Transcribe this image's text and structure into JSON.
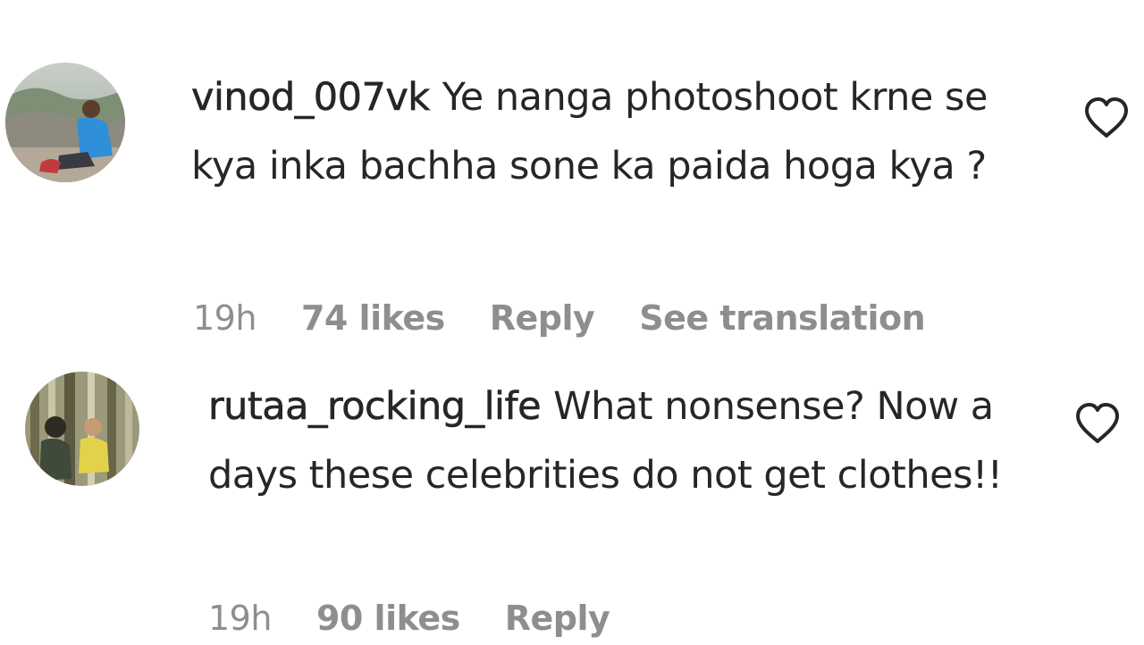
{
  "comments": [
    {
      "username": "vinod_007vk",
      "text": "Ye nanga photoshoot krne se kya inka bachha sone ka paida hoga kya ?",
      "time": "19h",
      "likes": "74 likes",
      "reply_label": "Reply",
      "translation_label": "See translation",
      "avatar_icon": "user-avatar-photo",
      "like_icon": "heart-outline-icon"
    },
    {
      "username": "rutaa_rocking_life",
      "text": "What nonsense? Now a days these celebrities do not get clothes!!",
      "time": "19h",
      "likes": "90 likes",
      "reply_label": "Reply",
      "avatar_icon": "user-avatar-photo",
      "like_icon": "heart-outline-icon"
    }
  ],
  "colors": {
    "text_primary": "#262626",
    "text_secondary": "#8e8e8e",
    "background": "#ffffff"
  }
}
